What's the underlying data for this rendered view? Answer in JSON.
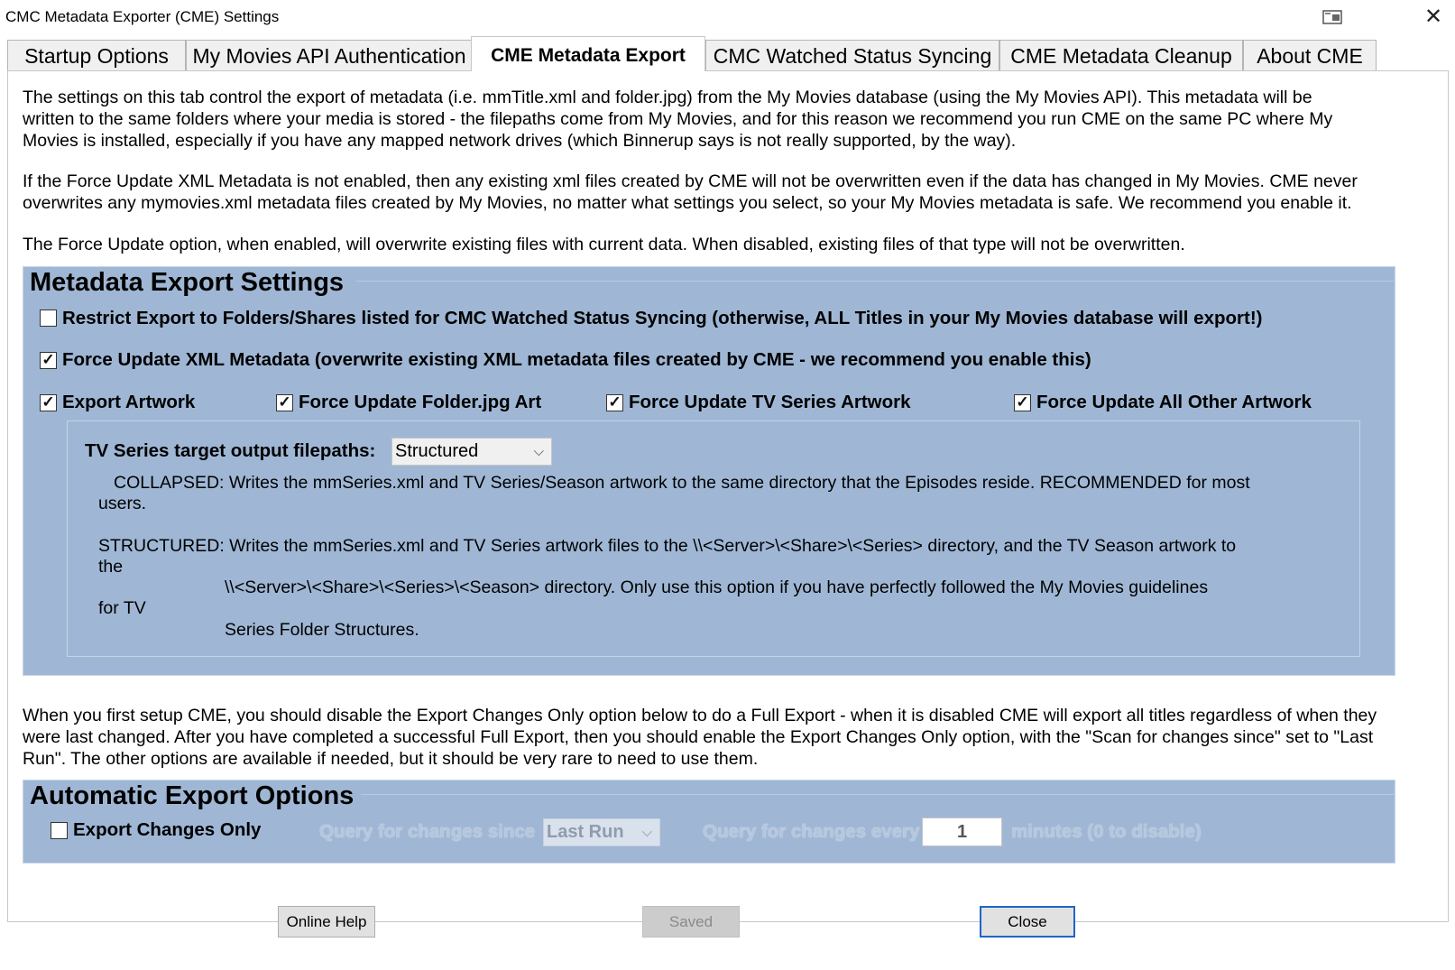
{
  "window": {
    "title": "CMC Metadata Exporter (CME) Settings",
    "restore_icon": "window-restore-icon",
    "close_glyph": "✕"
  },
  "tabs": [
    {
      "label": "Startup Options"
    },
    {
      "label": "My Movies API Authentication"
    },
    {
      "label": "CME Metadata Export",
      "active": true
    },
    {
      "label": "CMC Watched Status Syncing"
    },
    {
      "label": "CME Metadata Cleanup"
    },
    {
      "label": "About CME"
    }
  ],
  "intro": {
    "p1": [
      "The settings on this tab control the export of metadata (i.e. mmTitle.xml and folder.jpg) from the My Movies database (using the My Movies API).  This metadata will be",
      "written to the same folders where your media is stored - the filepaths come from My Movies, and for this reason we recommend you run CME on the same PC where My",
      "Movies is installed, especially if you have any mapped network drives (which Binnerup says is not really supported, by the way)."
    ],
    "p2": [
      "If the Force Update XML Metadata is not enabled, then any existing xml files created by CME will not be overwritten even if the data has changed in My Movies.  CME never",
      "overwrites any mymovies.xml metadata files created by My Movies, no matter what settings you select, so your My Movies metadata is safe.  We recommend you enable it."
    ],
    "p3": [
      "The Force Update option, when enabled, will overwrite existing files with current data.  When disabled, existing files of that type will not be overwritten."
    ]
  },
  "metadata_group": {
    "title": "Metadata Export Settings",
    "restrict": {
      "label": "Restrict Export to Folders/Shares listed for CMC Watched Status Syncing (otherwise, ALL Titles in your My Movies database will export!)",
      "checked": false
    },
    "force_xml": {
      "label": "Force Update XML Metadata (overwrite existing XML metadata files created by CME - we recommend you enable this)",
      "checked": true
    },
    "export_artwork": {
      "label": "Export Artwork",
      "checked": true
    },
    "force_folder": {
      "label": "Force Update Folder.jpg Art",
      "checked": true
    },
    "force_tv": {
      "label": "Force Update TV Series Artwork",
      "checked": true
    },
    "force_other": {
      "label": "Force Update All Other Artwork",
      "checked": true
    },
    "check_glyph": "✓",
    "tv_paths": {
      "label": "TV Series target output filepaths:",
      "value": "Structured",
      "chevron": "⌵",
      "collapsed": [
        "COLLAPSED:  Writes the mmSeries.xml and TV Series/Season artwork to the same directory that the Episodes reside.  RECOMMENDED for most",
        "users."
      ],
      "structured": [
        "STRUCTURED:  Writes the mmSeries.xml and TV Series artwork files to the \\\\<Server>\\<Share>\\<Series> directory, and the TV Season artwork to",
        "the",
        "\\\\<Server>\\<Share>\\<Series>\\<Season> directory.  Only use this option if you have perfectly followed the My Movies guidelines",
        "for TV",
        "Series Folder Structures."
      ]
    }
  },
  "full_export_note": [
    "When you first setup CME, you should disable the Export Changes Only option below to do a Full Export - when it is disabled CME will export all titles regardless of when they",
    "were last changed.  After you have completed a successful Full Export, then you should enable the Export Changes Only option, with the \"Scan for changes since\" set to \"Last",
    "Run\".  The other options are available if needed, but it should be very rare to need to use them."
  ],
  "auto_group": {
    "title": "Automatic Export Options",
    "changes_only": {
      "label": "Export Changes Only",
      "checked": false
    },
    "since_label": "Query for changes since",
    "since_value": "Last Run",
    "every_label": "Query for changes every",
    "every_value": "1",
    "minutes_label": "minutes (0 to disable)"
  },
  "buttons": {
    "help": "Online Help",
    "saved": "Saved",
    "close": "Close"
  },
  "colors": {
    "group_bg": "#9fb7d5",
    "default_button_border": "#1e66c8"
  }
}
